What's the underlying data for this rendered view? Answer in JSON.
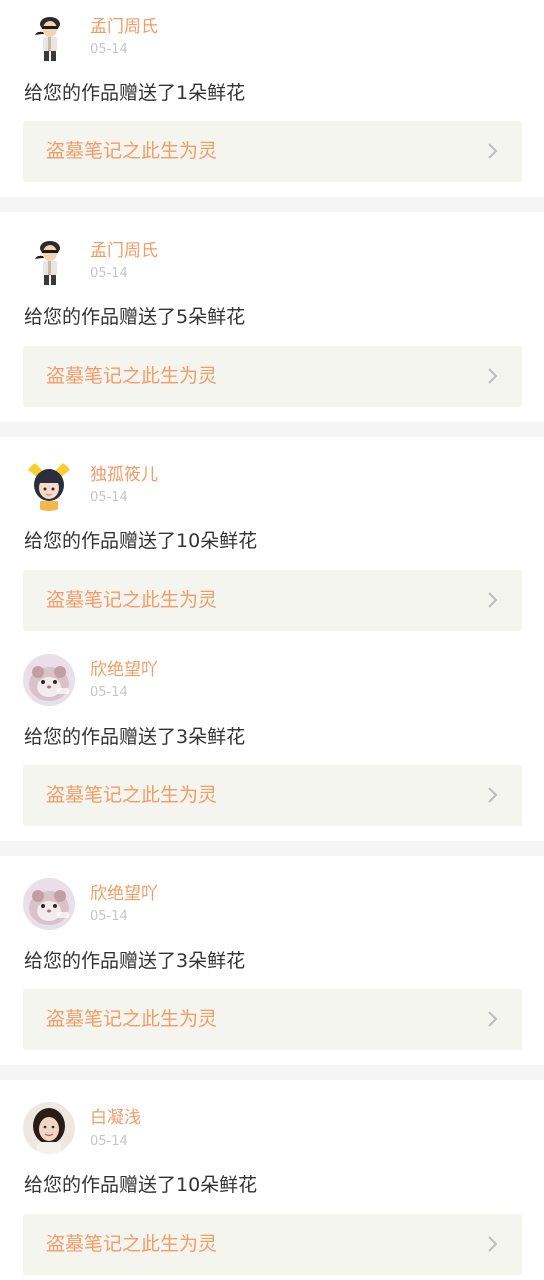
{
  "notifications": [
    {
      "username": "孟门周氏",
      "date": "05-14",
      "message": "给您的作品赠送了1朵鲜花",
      "work_title": "盗墓笔记之此生为灵",
      "avatar_icon": "cartoon-man-avatar"
    },
    {
      "username": "孟门周氏",
      "date": "05-14",
      "message": "给您的作品赠送了5朵鲜花",
      "work_title": "盗墓笔记之此生为灵",
      "avatar_icon": "cartoon-man-avatar"
    },
    {
      "username": "独孤筱儿",
      "date": "05-14",
      "message": "给您的作品赠送了10朵鲜花",
      "work_title": "盗墓笔记之此生为灵",
      "avatar_icon": "cartoon-girl-avatar"
    },
    {
      "username": "欣绝望吖",
      "date": "05-14",
      "message": "给您的作品赠送了3朵鲜花",
      "work_title": "盗墓笔记之此生为灵",
      "avatar_icon": "hamster-avatar"
    },
    {
      "username": "欣绝望吖",
      "date": "05-14",
      "message": "给您的作品赠送了3朵鲜花",
      "work_title": "盗墓笔记之此生为灵",
      "avatar_icon": "hamster-avatar"
    },
    {
      "username": "白凝浅",
      "date": "05-14",
      "message": "给您的作品赠送了10朵鲜花",
      "work_title": "盗墓笔记之此生为灵",
      "avatar_icon": "woman-photo-avatar"
    }
  ],
  "colors": {
    "accent": "#f39c67",
    "date_gray": "#c6c6c6",
    "text": "#333333",
    "card_bg": "#f5f5ef",
    "separator": "#f5f5f5"
  }
}
